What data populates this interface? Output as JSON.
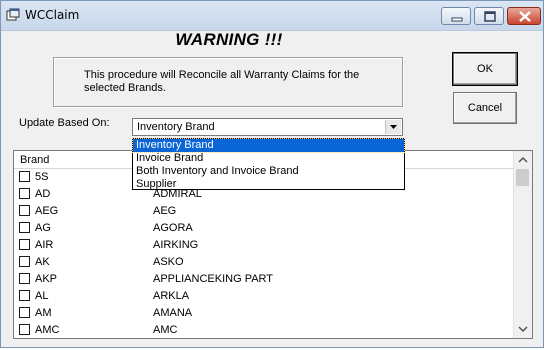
{
  "window": {
    "title": "WCClaim"
  },
  "warning": "WARNING !!!",
  "message": "This procedure will Reconcile all Warranty Claims for the selected Brands.",
  "buttons": {
    "ok": "OK",
    "cancel": "Cancel"
  },
  "update": {
    "label": "Update Based On:",
    "selected": "Inventory Brand",
    "options": [
      "Inventory Brand",
      "Invoice Brand",
      "Both Inventory and Invoice Brand",
      "Supplier"
    ]
  },
  "list": {
    "header": "Brand",
    "rows": [
      {
        "code": "5S",
        "name": ""
      },
      {
        "code": "AD",
        "name": "ADMIRAL"
      },
      {
        "code": "AEG",
        "name": "AEG"
      },
      {
        "code": "AG",
        "name": "AGORA"
      },
      {
        "code": "AIR",
        "name": "AIRKING"
      },
      {
        "code": "AK",
        "name": "ASKO"
      },
      {
        "code": "AKP",
        "name": "APPLIANCEKING PART"
      },
      {
        "code": "AL",
        "name": "ARKLA"
      },
      {
        "code": "AM",
        "name": "AMANA"
      },
      {
        "code": "AMC",
        "name": "AMC"
      }
    ]
  }
}
